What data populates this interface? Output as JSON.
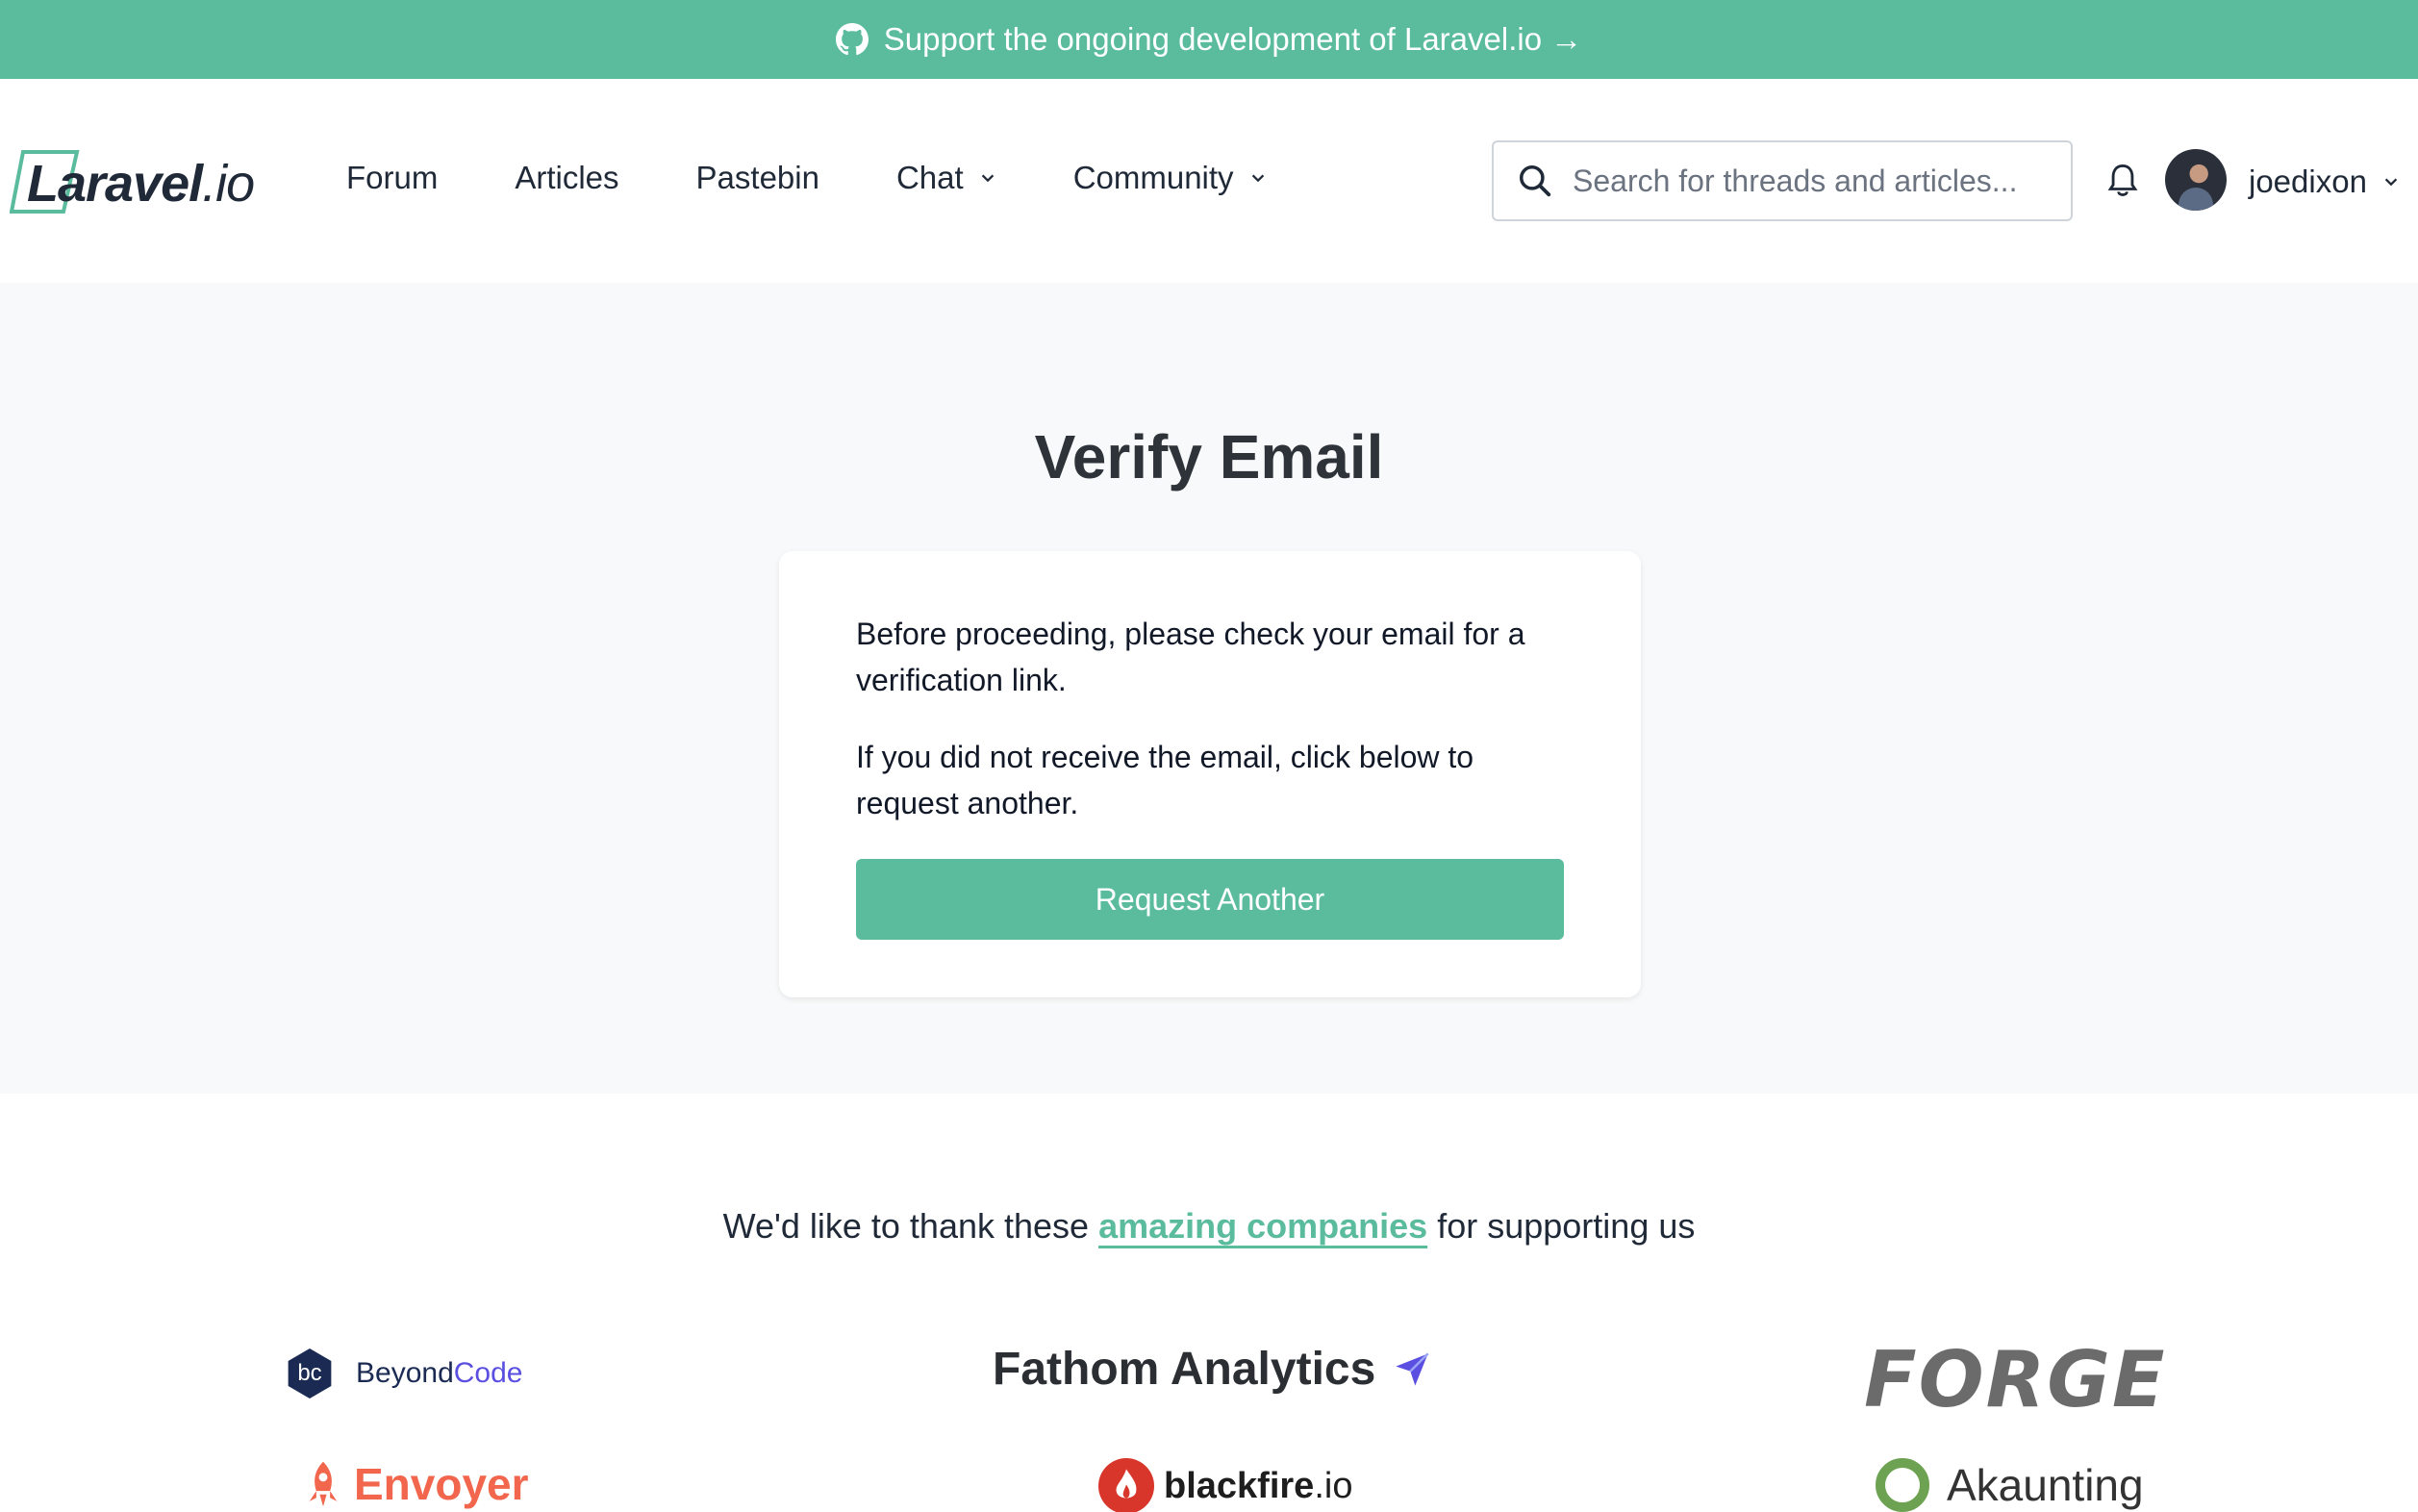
{
  "banner": {
    "text": "Support the ongoing development of Laravel.io →",
    "icon": "github-icon"
  },
  "header": {
    "logo_main": "Laravel",
    "logo_suffix": ".io",
    "nav": [
      {
        "label": "Forum"
      },
      {
        "label": "Articles"
      },
      {
        "label": "Pastebin"
      },
      {
        "label": "Chat",
        "dropdown": true
      },
      {
        "label": "Community",
        "dropdown": true
      }
    ],
    "search_placeholder": "Search for threads and articles...",
    "username": "joedixon"
  },
  "main": {
    "title": "Verify Email",
    "paragraph1": "Before proceeding, please check your email for a verification link.",
    "paragraph2": "If you did not receive the email, click below to request another.",
    "button_label": "Request Another"
  },
  "sponsors": {
    "intro_before": "We'd like to thank these",
    "intro_link": "amazing companies",
    "intro_after": "for supporting us",
    "beyondcode_badge": "bc",
    "beyondcode_a": "Beyond",
    "beyondcode_b": "Code",
    "fathom": "Fathom Analytics",
    "forge": "FORGE",
    "envoyer": "Envoyer",
    "blackfire_a": "blackfire",
    "blackfire_b": ".io",
    "akaunting": "Akaunting"
  },
  "colors": {
    "accent": "#5abb9d",
    "page_bg": "#f8f9fa",
    "text": "#1f2937"
  }
}
